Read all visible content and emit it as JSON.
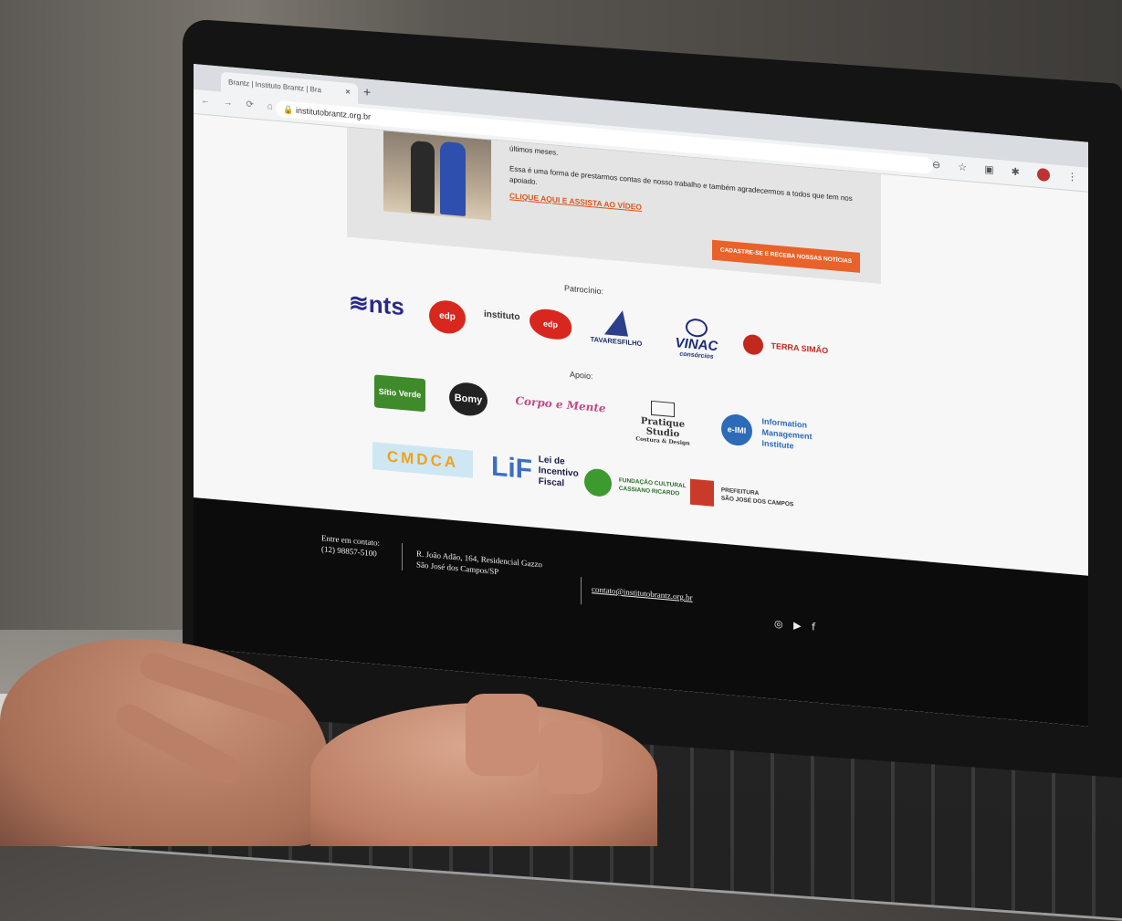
{
  "browser": {
    "tab_title": "Brantz | Instituto Brantz | Bra",
    "tab_close": "×",
    "tab_new": "+",
    "nav_icons": "← → ⟳ ⌂",
    "url": "institutobrantz.org.br",
    "toolbar_icons": [
      "zoom-icon",
      "star-icon",
      "translate-icon",
      "extensions-icon",
      "profile-avatar",
      "menu-icon"
    ],
    "zoom_glyph": "⊖",
    "star_glyph": "☆",
    "translate_glyph": "▣",
    "ext_glyph": "✱",
    "menu_glyph": "⋮"
  },
  "news": {
    "text_line1": "últimos meses.",
    "text_line2": "Essa é uma forma de prestarmos contas de nosso trabalho e também agradecermos a todos que tem nos apoiado.",
    "link": "CLIQUE AQUI E ASSISTA AO VÍDEO",
    "cta": "CADASTRE-SE E RECEBA NOSSAS NOTÍCIAS"
  },
  "sponsors": {
    "heading": "Patrocínio:",
    "nts": "≋nts",
    "edp": "edp",
    "instituto": "instituto",
    "edp2": "edp",
    "tavares": "TAVARESFILHO",
    "vinac": "VINAC",
    "vinac_sub": "consórcios",
    "terra": "TERRA SIMÃO"
  },
  "support": {
    "heading": "Apoio:",
    "sitio": "Sítio Verde",
    "bomy": "Bomy",
    "corpo": "Corpo e Mente",
    "pratique": "Pratique Studio",
    "pratique_sub": "Costura & Design",
    "emi_mark": "e-IMI",
    "emi_line1": "Information",
    "emi_line2": "Management",
    "emi_line3": "Institute",
    "cmdca": "CMDCA",
    "lif_mark": "LiF",
    "lif_line1": "Lei de",
    "lif_line2": "Incentivo",
    "lif_line3": "Fiscal",
    "fund_line1": "FUNDAÇÃO CULTURAL",
    "fund_line2": "CASSIANO RICARDO",
    "pref_line1": "PREFEITURA",
    "pref_line2": "SÃO JOSÉ DOS CAMPOS"
  },
  "footer": {
    "contact_label": "Entre em contato:",
    "phone": "(12) 98857-5100",
    "address_line1": "R. João Adão, 164, Residencial Gazzo",
    "address_line2": "São José dos Campos/SP",
    "email": "contato@institutobrantz.org.br",
    "social_instagram": "◎",
    "social_youtube": "▶",
    "social_facebook": "f"
  }
}
